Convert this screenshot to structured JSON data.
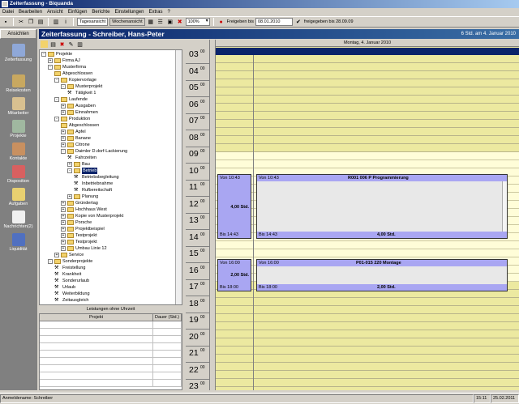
{
  "window": {
    "title": "Zeiterfassung - Biquanda"
  },
  "menu": [
    "Datei",
    "Bearbeiten",
    "Ansicht",
    "Einfügen",
    "Berichte",
    "Einstellungen",
    "Extras",
    "?"
  ],
  "toolbar": {
    "day_view": "Tagesansicht",
    "week_view": "Wochenansicht",
    "zoom": "100%",
    "release_until_label": "Freigeben bis",
    "release_until_date": "08.01.2010",
    "released_until": "freigegeben bis 28.09.09"
  },
  "leftnav": {
    "header": "Ansichten",
    "items": [
      {
        "label": "Zeiterfassung",
        "icon": "clock-icon",
        "color": "#8fa8d8"
      },
      {
        "label": "Reisekosten",
        "icon": "travel-icon",
        "color": "#c8a860"
      },
      {
        "label": "Mitarbeiter",
        "icon": "employee-icon",
        "color": "#d8c090"
      },
      {
        "label": "Projekte",
        "icon": "project-icon",
        "color": "#a0b8a0"
      },
      {
        "label": "Kontakte",
        "icon": "contacts-icon",
        "color": "#c89060"
      },
      {
        "label": "Disposition",
        "icon": "calendar-grid-icon",
        "color": "#d86060"
      },
      {
        "label": "Aufgaben",
        "icon": "tasks-icon",
        "color": "#e8d070"
      },
      {
        "label": "Nachrichten(2)",
        "icon": "messages-icon",
        "color": "#f0f0f0"
      },
      {
        "label": "Liquidität",
        "icon": "liquidity-icon",
        "color": "#5070c0"
      }
    ]
  },
  "header": {
    "title": "Zeiterfassung - Schreiber, Hans-Peter",
    "date_info": "6 Std. am 4. Januar 2010"
  },
  "tree": [
    {
      "label": "Projekte",
      "level": 0,
      "type": "folder",
      "exp": "-"
    },
    {
      "label": "Firma AJ",
      "level": 1,
      "type": "folder",
      "exp": "+"
    },
    {
      "label": "Musterfirma",
      "level": 1,
      "type": "folder",
      "exp": "-"
    },
    {
      "label": "Abgeschlossen",
      "level": 2,
      "type": "folder",
      "exp": ""
    },
    {
      "label": "Kopiervorlage",
      "level": 2,
      "type": "folder",
      "exp": "-"
    },
    {
      "label": "Musterprojekt",
      "level": 3,
      "type": "folder",
      "exp": "-"
    },
    {
      "label": "Tätigkeit 1",
      "level": 4,
      "type": "task",
      "exp": ""
    },
    {
      "label": "Laufende",
      "level": 2,
      "type": "folder",
      "exp": "-"
    },
    {
      "label": "Ausgaben",
      "level": 3,
      "type": "folder",
      "exp": "+"
    },
    {
      "label": "Einnahmen",
      "level": 3,
      "type": "folder",
      "exp": "+"
    },
    {
      "label": "Produktion",
      "level": 2,
      "type": "folder",
      "exp": "-"
    },
    {
      "label": "Abgeschlossen",
      "level": 3,
      "type": "folder",
      "exp": ""
    },
    {
      "label": "Apfel",
      "level": 3,
      "type": "folder",
      "exp": "+"
    },
    {
      "label": "Banane",
      "level": 3,
      "type": "folder",
      "exp": "+"
    },
    {
      "label": "Citrone",
      "level": 3,
      "type": "folder",
      "exp": "+"
    },
    {
      "label": "Daimler D.dorf-Lackierung",
      "level": 3,
      "type": "folder",
      "exp": "-"
    },
    {
      "label": "Fahrzeiten",
      "level": 4,
      "type": "task",
      "exp": ""
    },
    {
      "label": "Bau",
      "level": 4,
      "type": "folder",
      "exp": "+"
    },
    {
      "label": "Betrieb",
      "level": 4,
      "type": "folder",
      "exp": "-",
      "selected": true
    },
    {
      "label": "Betriebsbegleitung",
      "level": 5,
      "type": "task",
      "exp": ""
    },
    {
      "label": "Inbetriebnahme",
      "level": 5,
      "type": "task",
      "exp": ""
    },
    {
      "label": "Rufbereitschaft",
      "level": 5,
      "type": "task",
      "exp": ""
    },
    {
      "label": "Planung",
      "level": 4,
      "type": "folder",
      "exp": "+"
    },
    {
      "label": "Gründertag",
      "level": 3,
      "type": "folder",
      "exp": "+"
    },
    {
      "label": "Hochhaus West",
      "level": 3,
      "type": "folder",
      "exp": "+"
    },
    {
      "label": "Kopie von Musterprojekt",
      "level": 3,
      "type": "folder",
      "exp": "+"
    },
    {
      "label": "Porsche",
      "level": 3,
      "type": "folder",
      "exp": "+"
    },
    {
      "label": "Projektbeispiel",
      "level": 3,
      "type": "folder",
      "exp": "+"
    },
    {
      "label": "Testprojekt",
      "level": 3,
      "type": "folder",
      "exp": "+"
    },
    {
      "label": "Testprojekt",
      "level": 3,
      "type": "folder",
      "exp": "+"
    },
    {
      "label": "Umbau Linie 12",
      "level": 3,
      "type": "folder",
      "exp": "+"
    },
    {
      "label": "Service",
      "level": 2,
      "type": "folder",
      "exp": "+"
    },
    {
      "label": "Sonderprojekte",
      "level": 1,
      "type": "folder",
      "exp": "-"
    },
    {
      "label": "Freistellung",
      "level": 2,
      "type": "task",
      "exp": ""
    },
    {
      "label": "Krankheit",
      "level": 2,
      "type": "task",
      "exp": ""
    },
    {
      "label": "Sonderurlaub",
      "level": 2,
      "type": "task",
      "exp": ""
    },
    {
      "label": "Urlaub",
      "level": 2,
      "type": "task",
      "exp": ""
    },
    {
      "label": "Weiterbildung",
      "level": 2,
      "type": "task",
      "exp": ""
    },
    {
      "label": "Zeitausgleich",
      "level": 2,
      "type": "task",
      "exp": ""
    }
  ],
  "leistungen": {
    "title": "Leistungen ohne Uhrzeit",
    "col_project": "Projekt",
    "col_duration": "Dauer (Std.)"
  },
  "calendar": {
    "day_header": "Montag, 4. Januar 2010",
    "minutes_label": "00",
    "hours": [
      "03",
      "04",
      "05",
      "06",
      "07",
      "08",
      "09",
      "10",
      "11",
      "12",
      "13",
      "14",
      "15",
      "16",
      "17",
      "18",
      "19",
      "20",
      "21",
      "22",
      "23"
    ],
    "appointments": [
      {
        "from": "Von 10:43",
        "to": "Bis 14:43",
        "duration": "4,00 Std.",
        "title": "R001 006  P  Programmierung",
        "total": "4,00 Std."
      },
      {
        "from": "Von 16:00",
        "to": "Bis 18:00",
        "duration": "2,00 Std.",
        "title": "P01-015  220  Montage",
        "total": "2,00 Std."
      }
    ]
  },
  "status": {
    "user": "Anmeldename: Schreiber",
    "time": "15:11",
    "date": "25.02.2011"
  }
}
